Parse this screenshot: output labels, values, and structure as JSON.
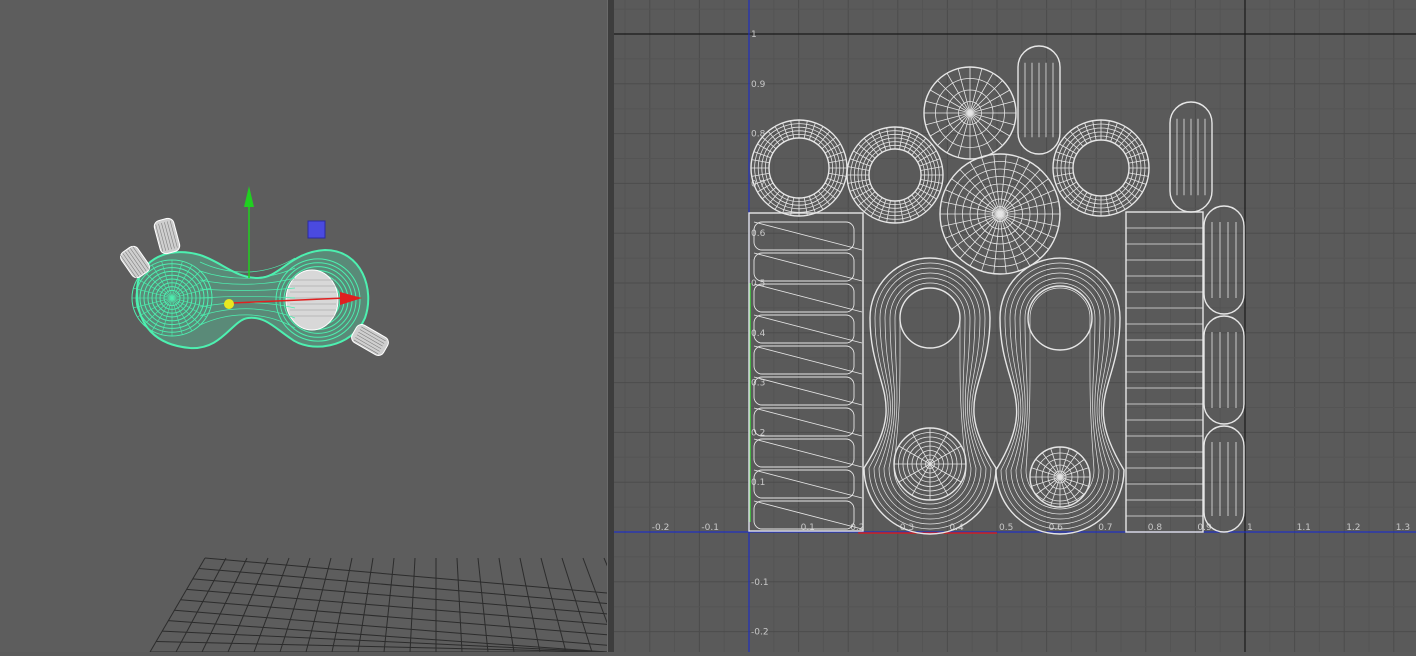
{
  "colors": {
    "wire_selected": "#4df0b0",
    "wire_default": "#e6e6e6",
    "manip_x": "#e02020",
    "manip_y": "#20d020",
    "manip_scale": "#4a4ae0",
    "pivot": "#e8e820",
    "uv_axis_u": "#2030c0",
    "uv_axis_v": "#2030c0",
    "uv_border_u": "#d02020",
    "uv_border_v": "#40d040",
    "tile_border": "#1a1a1a"
  },
  "uv_editor": {
    "u_ticks": [
      "-0.2",
      "-0.1",
      "0.1",
      "0.2",
      "0.3",
      "0.4",
      "0.5",
      "0.6",
      "0.7",
      "0.8",
      "0.9",
      "1",
      "1.1",
      "1.2",
      "1.3"
    ],
    "v_ticks": [
      "1",
      "0.9",
      "0.8",
      "0.7",
      "0.6",
      "0.5",
      "0.4",
      "0.3",
      "0.2",
      "0.1",
      "-0.1",
      "-0.2"
    ]
  },
  "viewport": {
    "manipulator": "move-manipulator",
    "selection": "selected-mesh"
  }
}
